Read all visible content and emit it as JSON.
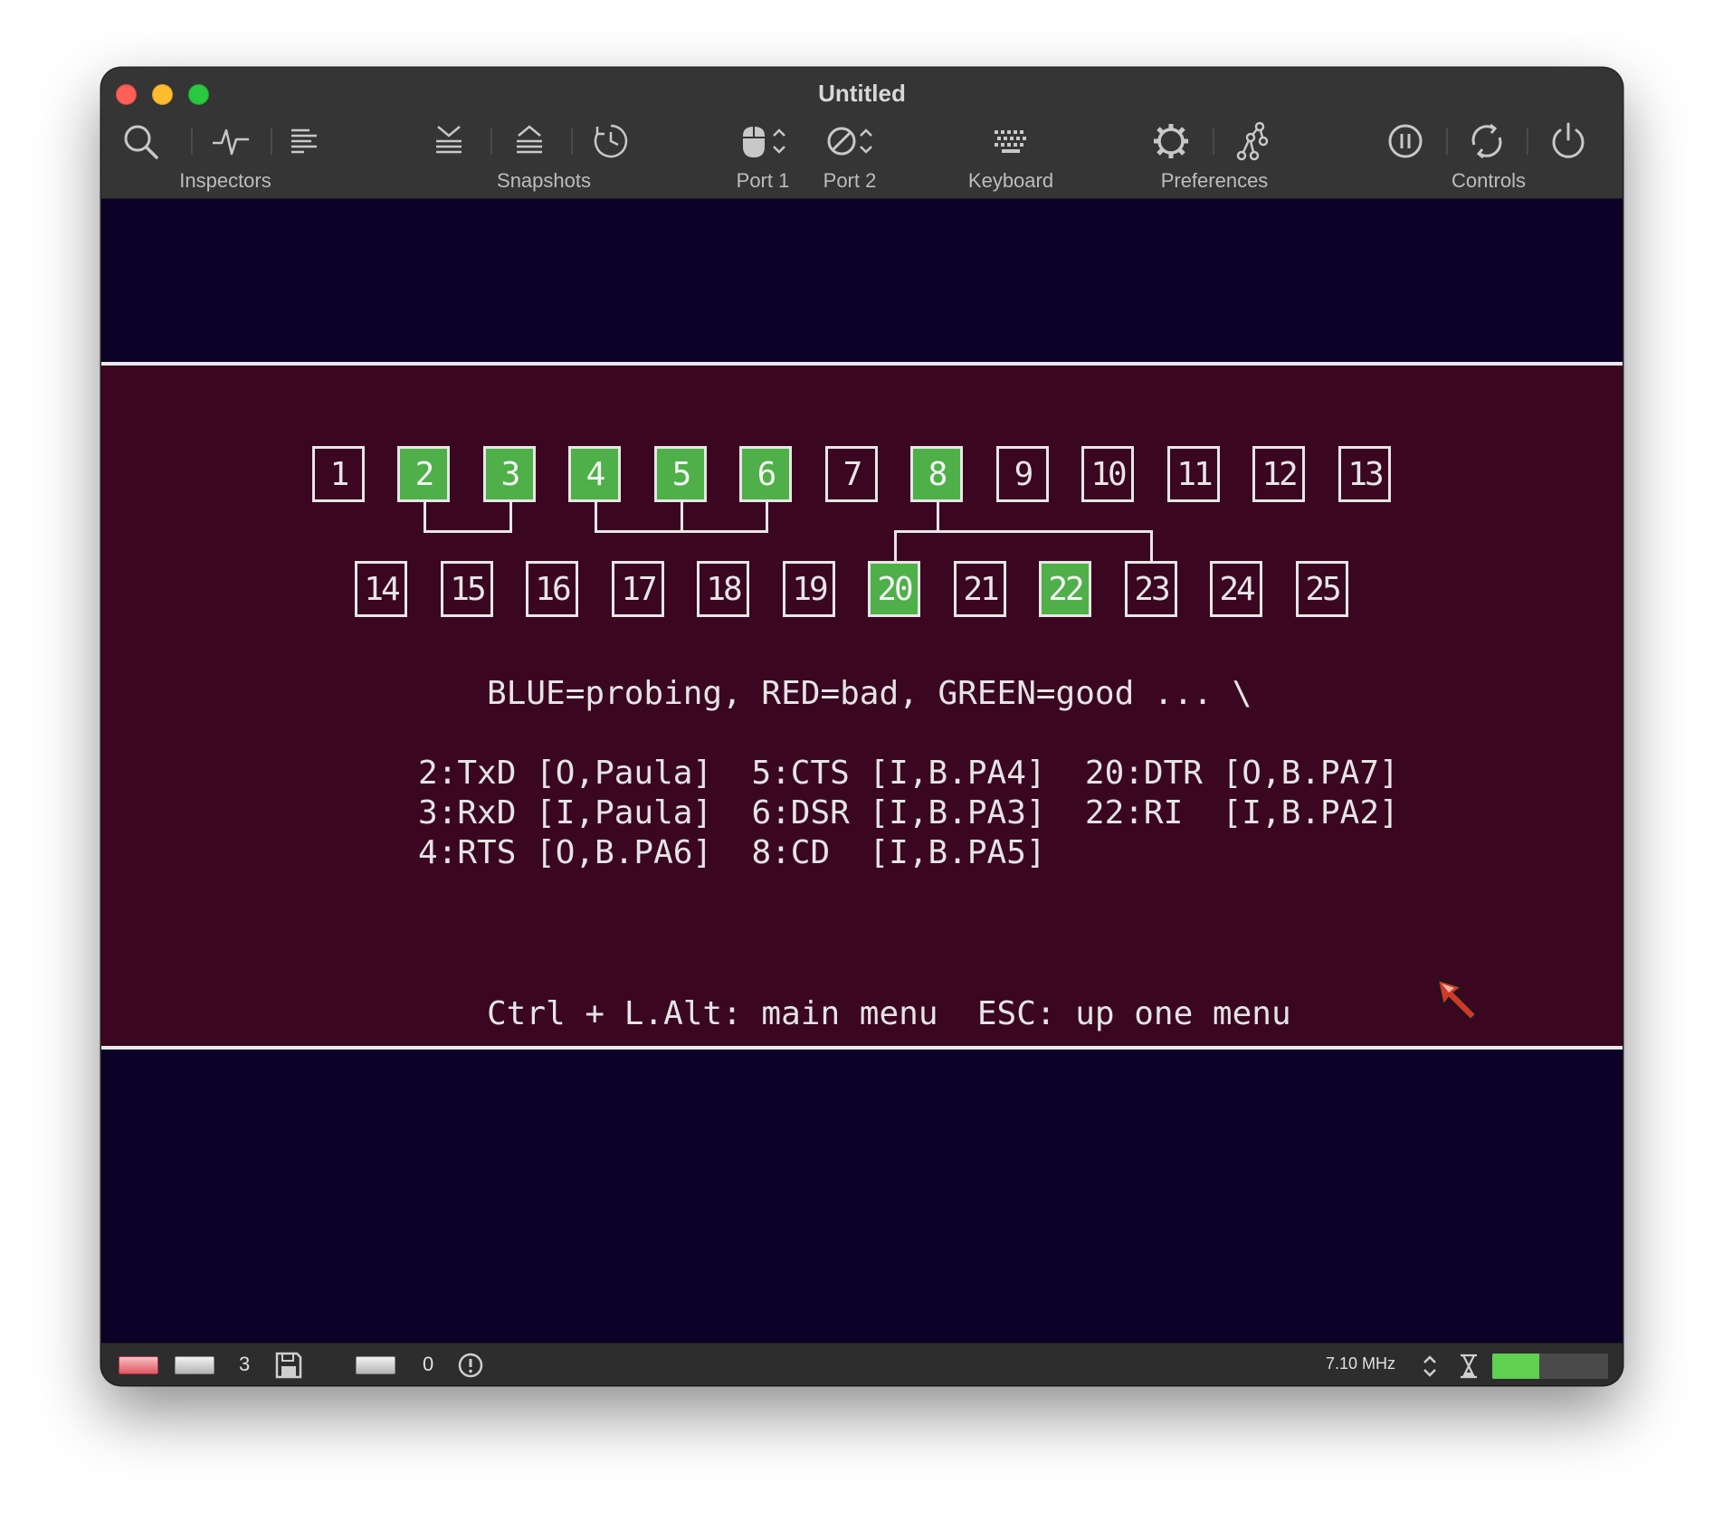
{
  "window": {
    "title": "Untitled"
  },
  "toolbar": {
    "groups": [
      {
        "label": "Inspectors",
        "icons": [
          "inspect-icon",
          "activity-icon",
          "console-icon"
        ]
      },
      {
        "label": "Snapshots",
        "icons": [
          "snapshot-take-icon",
          "snapshot-restore-icon",
          "snapshot-browse-icon"
        ]
      },
      {
        "label": "Port 1",
        "icons": [
          "mouse-icon",
          "stepper-icon"
        ]
      },
      {
        "label": "Port 2",
        "icons": [
          "none-icon",
          "stepper-icon"
        ]
      },
      {
        "label": "Keyboard",
        "icons": [
          "keyboard-icon"
        ]
      },
      {
        "label": "Preferences",
        "icons": [
          "gear-icon",
          "hardware-icon"
        ]
      },
      {
        "label": "Controls",
        "icons": [
          "pause-icon",
          "reset-icon",
          "power-icon"
        ]
      }
    ]
  },
  "screen": {
    "pins_row1": [
      {
        "num": "1",
        "status": "none"
      },
      {
        "num": "2",
        "status": "good"
      },
      {
        "num": "3",
        "status": "good"
      },
      {
        "num": "4",
        "status": "good"
      },
      {
        "num": "5",
        "status": "good"
      },
      {
        "num": "6",
        "status": "good"
      },
      {
        "num": "7",
        "status": "none"
      },
      {
        "num": "8",
        "status": "good"
      },
      {
        "num": "9",
        "status": "none"
      },
      {
        "num": "10",
        "status": "none"
      },
      {
        "num": "11",
        "status": "none"
      },
      {
        "num": "12",
        "status": "none"
      },
      {
        "num": "13",
        "status": "none"
      }
    ],
    "pins_row2": [
      {
        "num": "14",
        "status": "none"
      },
      {
        "num": "15",
        "status": "none"
      },
      {
        "num": "16",
        "status": "none"
      },
      {
        "num": "17",
        "status": "none"
      },
      {
        "num": "18",
        "status": "none"
      },
      {
        "num": "19",
        "status": "none"
      },
      {
        "num": "20",
        "status": "good"
      },
      {
        "num": "21",
        "status": "none"
      },
      {
        "num": "22",
        "status": "good"
      },
      {
        "num": "23",
        "status": "none"
      },
      {
        "num": "24",
        "status": "none"
      },
      {
        "num": "25",
        "status": "none"
      }
    ],
    "legend": "BLUE=probing, RED=bad, GREEN=good ... \\",
    "signal_lines": [
      "2:TxD [O,Paula]  5:CTS [I,B.PA4]  20:DTR [O,B.PA7]",
      "3:RxD [I,Paula]  6:DSR [I,B.PA3]  22:RI  [I,B.PA2]",
      "4:RTS [O,B.PA6]  8:CD  [I,B.PA5]"
    ],
    "footer": "Ctrl + L.Alt: main menu  ESC: up one menu",
    "colors": {
      "border": "#0c0228",
      "paper": "#3a0620",
      "good": "#4fb04a",
      "text": "#e4e4e4"
    }
  },
  "statusbar": {
    "drive_count": "3",
    "counter": "0",
    "frequency": "7.10 MHz",
    "speed_fill_fraction": 0.41,
    "colors": {
      "speed": "#5fd04f",
      "power_led": "#e05560"
    }
  }
}
